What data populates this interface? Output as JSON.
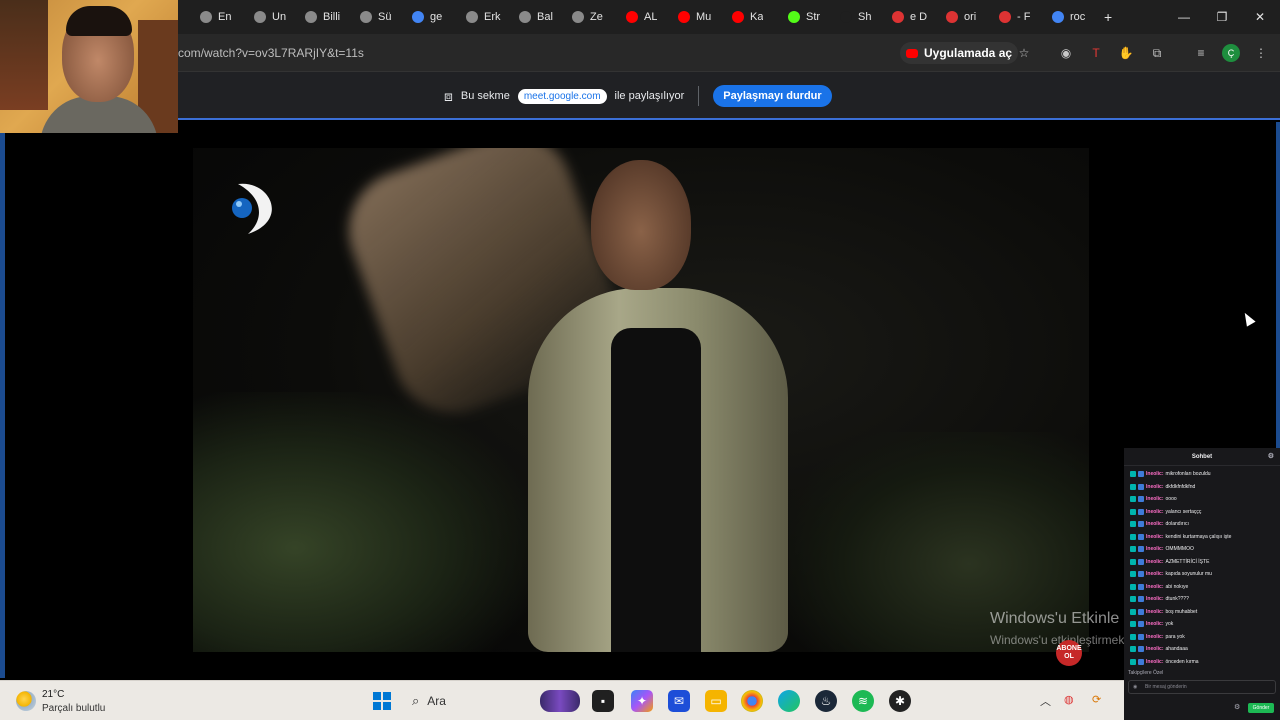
{
  "browser": {
    "tabs": [
      {
        "label": "En",
        "icon": "globe-icon",
        "color": "#8a8a8a"
      },
      {
        "label": "Un",
        "icon": "globe-icon",
        "color": "#8a8a8a"
      },
      {
        "label": "Billi",
        "icon": "pt-icon",
        "color": "#8a8a8a"
      },
      {
        "label": "Sü",
        "icon": "globe-icon",
        "color": "#8a8a8a"
      },
      {
        "label": "ge",
        "icon": "google-icon",
        "color": "#4285f4"
      },
      {
        "label": "Erk",
        "icon": "openai-icon",
        "color": "#8a8a8a"
      },
      {
        "label": "Bal",
        "icon": "openai-icon",
        "color": "#8a8a8a"
      },
      {
        "label": "Ze",
        "icon": "openai-icon",
        "color": "#8a8a8a"
      },
      {
        "label": "AL",
        "icon": "youtube-icon",
        "color": "#ff0000"
      },
      {
        "label": "Mu",
        "icon": "youtube-icon",
        "color": "#ff0000"
      },
      {
        "label": "Ka",
        "icon": "youtube-icon",
        "color": "#ff0000"
      },
      {
        "label": "Str",
        "icon": "kick-icon",
        "color": "#53fc18"
      },
      {
        "label": "Sh",
        "icon": "globe-icon",
        "color": "#1f1f1f"
      },
      {
        "label": "e D",
        "icon": "circle-icon",
        "color": "#d33"
      },
      {
        "label": "ori",
        "icon": "circle-icon",
        "color": "#d33"
      },
      {
        "label": "- F",
        "icon": "circle-icon",
        "color": "#d33"
      },
      {
        "label": "roc",
        "icon": "google-icon",
        "color": "#4285f4"
      }
    ],
    "new_tab": "+",
    "url": "com/watch?v=ov3L7RARjIY&t=11s",
    "open_in_app": "Uygulamada aç"
  },
  "share": {
    "prefix": "Bu sekme",
    "domain": "meet.google.com",
    "suffix": "ile paylaşılıyor",
    "stop": "Paylaşmayı durdur"
  },
  "video": {
    "watermark_line1": "Windows'u Etkinle",
    "watermark_line2": "Windows'u etkinleştirmek",
    "subscribe_line1": "ABONE",
    "subscribe_line2": "OL"
  },
  "chat": {
    "title": "Sohbet",
    "messages": [
      {
        "user": "Ineolic:",
        "text": "mikrofonları bozuldu"
      },
      {
        "user": "Ineolic:",
        "text": "dkfdkfnfdkfnd"
      },
      {
        "user": "Ineolic:",
        "text": "oooo"
      },
      {
        "user": "Ineolic:",
        "text": "yalancı sertaççç"
      },
      {
        "user": "Ineolic:",
        "text": "dolandırıcı"
      },
      {
        "user": "Ineolic:",
        "text": "kendini kurtarmaya çalışıı işte"
      },
      {
        "user": "Ineolic:",
        "text": "OMMMMOO"
      },
      {
        "user": "Ineolic:",
        "text": "AZMETTİRİCİ İŞTE"
      },
      {
        "user": "Ineolic:",
        "text": "kapıda soyunulur mu"
      },
      {
        "user": "Ineolic:",
        "text": "abi nokıye"
      },
      {
        "user": "Ineolic:",
        "text": "dtunk????"
      },
      {
        "user": "Ineolic:",
        "text": "boş muhabbet"
      },
      {
        "user": "Ineolic:",
        "text": "yok"
      },
      {
        "user": "Ineolic:",
        "text": "para yok"
      },
      {
        "user": "Ineolic:",
        "text": "ahandaaa"
      },
      {
        "user": "Ineolic:",
        "text": "önceden kırma"
      }
    ],
    "footer_note": "Takipçilere Özel",
    "input_placeholder": "Bir mesaj gönderin",
    "send": "Gönder"
  },
  "taskbar": {
    "temperature": "21°C",
    "condition": "Parçalı bulutlu",
    "search_placeholder": "Ara"
  }
}
